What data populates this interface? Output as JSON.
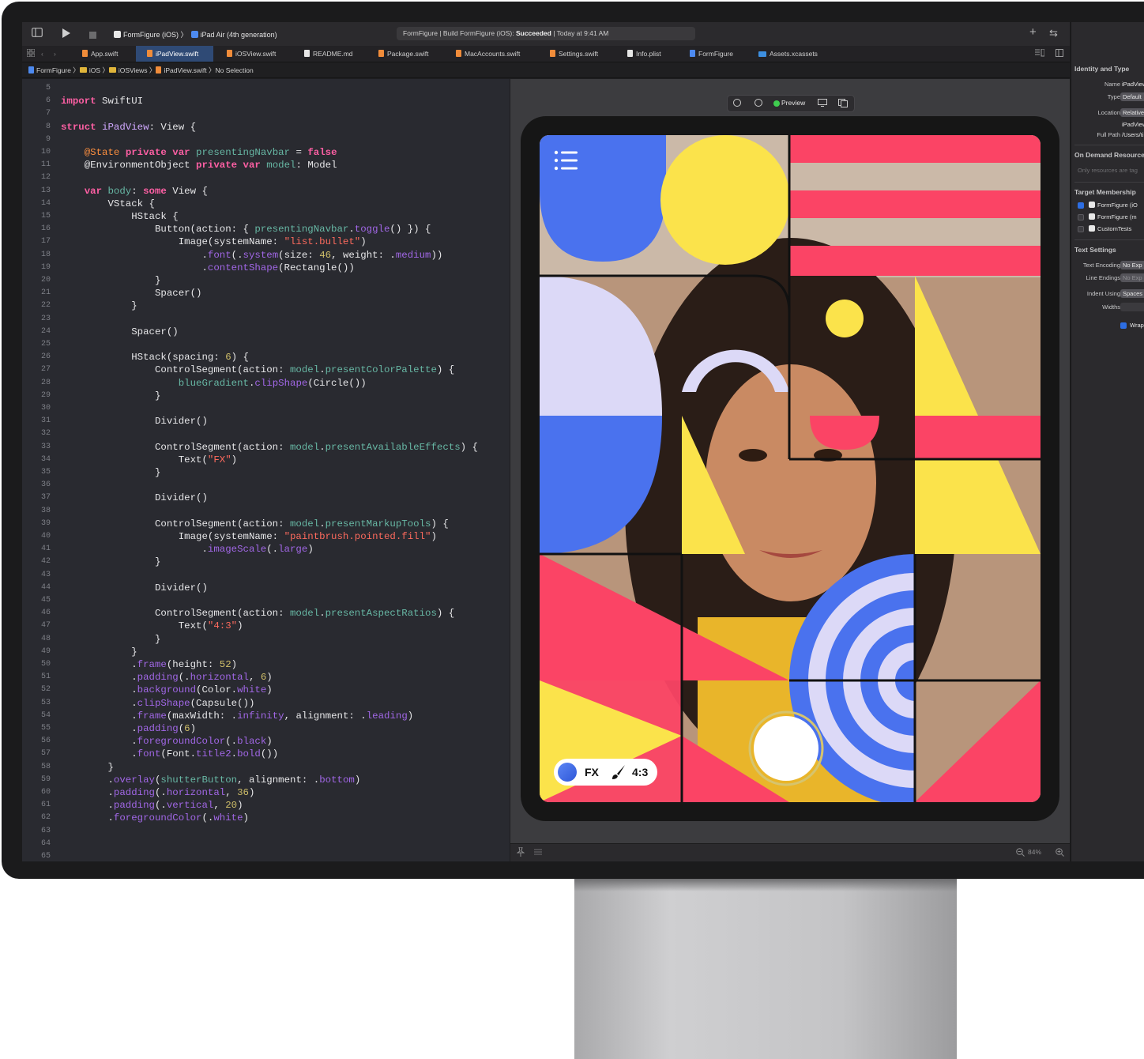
{
  "toolbar": {
    "scheme": "FormFigure (iOS)",
    "device": "iPad Air (4th generation)",
    "status_prefix": "FormFigure | Build FormFigure (iOS): ",
    "status_result": "Succeeded",
    "status_time": " | Today at 9:41 AM",
    "add_label": "+",
    "swap_label": "⇆"
  },
  "tabs": [
    {
      "label": "App.swift"
    },
    {
      "label": "iPadView.swift"
    },
    {
      "label": "iOSView.swift"
    },
    {
      "label": "README.md"
    },
    {
      "label": "Package.swift"
    },
    {
      "label": "MacAccounts.swift"
    },
    {
      "label": "Settings.swift"
    },
    {
      "label": "Info.plist"
    },
    {
      "label": "FormFigure"
    },
    {
      "label": "Assets.xcassets"
    }
  ],
  "breadcrumb": {
    "project": "FormFigure",
    "group1": "iOS",
    "group2": "iOSViews",
    "file": "iPadView.swift",
    "selection": "No Selection"
  },
  "editor": {
    "line_numbers": [
      "5",
      "6",
      "7",
      "8",
      "9",
      "10",
      "11",
      "12",
      "13",
      "14",
      "15",
      "16",
      "17",
      "18",
      "19",
      "20",
      "21",
      "22",
      "23",
      "24",
      "25",
      "26",
      "27",
      "28",
      "29",
      "30",
      "31",
      "32",
      "33",
      "34",
      "35",
      "36",
      "37",
      "38",
      "39",
      "40",
      "41",
      "42",
      "43",
      "44",
      "45",
      "46",
      "47",
      "48",
      "49",
      "50",
      "51",
      "52",
      "53",
      "54",
      "55",
      "56",
      "57",
      "58",
      "59",
      "60",
      "61",
      "62",
      "63",
      "64",
      "65"
    ],
    "lines": [
      [],
      [
        [
          "kw",
          "import"
        ],
        [
          "p",
          " SwiftUI"
        ]
      ],
      [],
      [
        [
          "kw",
          "struct"
        ],
        [
          "p",
          " "
        ],
        [
          "ty",
          "iPadView"
        ],
        [
          "p",
          ": View {"
        ]
      ],
      [],
      [
        [
          "p",
          "    "
        ],
        [
          "at",
          "@State"
        ],
        [
          "p",
          " "
        ],
        [
          "kw",
          "private var"
        ],
        [
          "p",
          " "
        ],
        [
          "fn",
          "presentingNavbar"
        ],
        [
          "p",
          " = "
        ],
        [
          "kw",
          "false"
        ]
      ],
      [
        [
          "p",
          "    @EnvironmentObject "
        ],
        [
          "kw",
          "private var"
        ],
        [
          "p",
          " "
        ],
        [
          "fn",
          "model"
        ],
        [
          "p",
          ": Model"
        ]
      ],
      [],
      [
        [
          "p",
          "    "
        ],
        [
          "kw",
          "var"
        ],
        [
          "p",
          " "
        ],
        [
          "fn",
          "body"
        ],
        [
          "p",
          ": "
        ],
        [
          "kw",
          "some"
        ],
        [
          "p",
          " View {"
        ]
      ],
      [
        [
          "p",
          "        VStack {"
        ]
      ],
      [
        [
          "p",
          "            HStack {"
        ]
      ],
      [
        [
          "p",
          "                Button(action: { "
        ],
        [
          "fn",
          "presentingNavbar"
        ],
        [
          "p",
          "."
        ],
        [
          "cs",
          "toggle"
        ],
        [
          "p",
          "() }) {"
        ]
      ],
      [
        [
          "p",
          "                    Image(systemName: "
        ],
        [
          "st",
          "\"list.bullet\""
        ],
        [
          "p",
          ")"
        ]
      ],
      [
        [
          "p",
          "                        ."
        ],
        [
          "cs",
          "font"
        ],
        [
          "p",
          "(."
        ],
        [
          "cs",
          "system"
        ],
        [
          "p",
          "(size: "
        ],
        [
          "nu",
          "46"
        ],
        [
          "p",
          ", weight: ."
        ],
        [
          "cs",
          "medium"
        ],
        [
          "p",
          "))"
        ]
      ],
      [
        [
          "p",
          "                        ."
        ],
        [
          "cs",
          "contentShape"
        ],
        [
          "p",
          "(Rectangle())"
        ]
      ],
      [
        [
          "p",
          "                }"
        ]
      ],
      [
        [
          "p",
          "                Spacer()"
        ]
      ],
      [
        [
          "p",
          "            }"
        ]
      ],
      [],
      [
        [
          "p",
          "            Spacer()"
        ]
      ],
      [],
      [
        [
          "p",
          "            HStack(spacing: "
        ],
        [
          "nu",
          "6"
        ],
        [
          "p",
          ") {"
        ]
      ],
      [
        [
          "p",
          "                ControlSegment(action: "
        ],
        [
          "fn",
          "model"
        ],
        [
          "p",
          "."
        ],
        [
          "fn",
          "presentColorPalette"
        ],
        [
          "p",
          ") {"
        ]
      ],
      [
        [
          "p",
          "                    "
        ],
        [
          "fn",
          "blueGradient"
        ],
        [
          "p",
          "."
        ],
        [
          "cs",
          "clipShape"
        ],
        [
          "p",
          "(Circle())"
        ]
      ],
      [
        [
          "p",
          "                }"
        ]
      ],
      [],
      [
        [
          "p",
          "                Divider()"
        ]
      ],
      [],
      [
        [
          "p",
          "                ControlSegment(action: "
        ],
        [
          "fn",
          "model"
        ],
        [
          "p",
          "."
        ],
        [
          "fn",
          "presentAvailableEffects"
        ],
        [
          "p",
          ") {"
        ]
      ],
      [
        [
          "p",
          "                    Text("
        ],
        [
          "st",
          "\"FX\""
        ],
        [
          "p",
          ")"
        ]
      ],
      [
        [
          "p",
          "                }"
        ]
      ],
      [],
      [
        [
          "p",
          "                Divider()"
        ]
      ],
      [],
      [
        [
          "p",
          "                ControlSegment(action: "
        ],
        [
          "fn",
          "model"
        ],
        [
          "p",
          "."
        ],
        [
          "fn",
          "presentMarkupTools"
        ],
        [
          "p",
          ") {"
        ]
      ],
      [
        [
          "p",
          "                    Image(systemName: "
        ],
        [
          "st",
          "\"paintbrush.pointed.fill\""
        ],
        [
          "p",
          ")"
        ]
      ],
      [
        [
          "p",
          "                        ."
        ],
        [
          "cs",
          "imageScale"
        ],
        [
          "p",
          "(."
        ],
        [
          "cs",
          "large"
        ],
        [
          "p",
          ")"
        ]
      ],
      [
        [
          "p",
          "                }"
        ]
      ],
      [],
      [
        [
          "p",
          "                Divider()"
        ]
      ],
      [],
      [
        [
          "p",
          "                ControlSegment(action: "
        ],
        [
          "fn",
          "model"
        ],
        [
          "p",
          "."
        ],
        [
          "fn",
          "presentAspectRatios"
        ],
        [
          "p",
          ") {"
        ]
      ],
      [
        [
          "p",
          "                    Text("
        ],
        [
          "st",
          "\"4:3\""
        ],
        [
          "p",
          ")"
        ]
      ],
      [
        [
          "p",
          "                }"
        ]
      ],
      [
        [
          "p",
          "            }"
        ]
      ],
      [
        [
          "p",
          "            ."
        ],
        [
          "cs",
          "frame"
        ],
        [
          "p",
          "(height: "
        ],
        [
          "nu",
          "52"
        ],
        [
          "p",
          ")"
        ]
      ],
      [
        [
          "p",
          "            ."
        ],
        [
          "cs",
          "padding"
        ],
        [
          "p",
          "(."
        ],
        [
          "cs",
          "horizontal"
        ],
        [
          "p",
          ", "
        ],
        [
          "nu",
          "6"
        ],
        [
          "p",
          ")"
        ]
      ],
      [
        [
          "p",
          "            ."
        ],
        [
          "cs",
          "background"
        ],
        [
          "p",
          "(Color."
        ],
        [
          "cs",
          "white"
        ],
        [
          "p",
          ")"
        ]
      ],
      [
        [
          "p",
          "            ."
        ],
        [
          "cs",
          "clipShape"
        ],
        [
          "p",
          "(Capsule())"
        ]
      ],
      [
        [
          "p",
          "            ."
        ],
        [
          "cs",
          "frame"
        ],
        [
          "p",
          "(maxWidth: ."
        ],
        [
          "cs",
          "infinity"
        ],
        [
          "p",
          ", alignment: ."
        ],
        [
          "cs",
          "leading"
        ],
        [
          "p",
          ")"
        ]
      ],
      [
        [
          "p",
          "            ."
        ],
        [
          "cs",
          "padding"
        ],
        [
          "p",
          "("
        ],
        [
          "nu",
          "6"
        ],
        [
          "p",
          ")"
        ]
      ],
      [
        [
          "p",
          "            ."
        ],
        [
          "cs",
          "foregroundColor"
        ],
        [
          "p",
          "(."
        ],
        [
          "cs",
          "black"
        ],
        [
          "p",
          ")"
        ]
      ],
      [
        [
          "p",
          "            ."
        ],
        [
          "cs",
          "font"
        ],
        [
          "p",
          "(Font."
        ],
        [
          "cs",
          "title2"
        ],
        [
          "p",
          "."
        ],
        [
          "cs",
          "bold"
        ],
        [
          "p",
          "())"
        ]
      ],
      [
        [
          "p",
          "        }"
        ]
      ],
      [
        [
          "p",
          "        ."
        ],
        [
          "cs",
          "overlay"
        ],
        [
          "p",
          "("
        ],
        [
          "fn",
          "shutterButton"
        ],
        [
          "p",
          ", alignment: ."
        ],
        [
          "cs",
          "bottom"
        ],
        [
          "p",
          ")"
        ]
      ],
      [
        [
          "p",
          "        ."
        ],
        [
          "cs",
          "padding"
        ],
        [
          "p",
          "(."
        ],
        [
          "cs",
          "horizontal"
        ],
        [
          "p",
          ", "
        ],
        [
          "nu",
          "36"
        ],
        [
          "p",
          ")"
        ]
      ],
      [
        [
          "p",
          "        ."
        ],
        [
          "cs",
          "padding"
        ],
        [
          "p",
          "(."
        ],
        [
          "cs",
          "vertical"
        ],
        [
          "p",
          ", "
        ],
        [
          "nu",
          "20"
        ],
        [
          "p",
          ")"
        ]
      ],
      [
        [
          "p",
          "        ."
        ],
        [
          "cs",
          "foregroundColor"
        ],
        [
          "p",
          "(."
        ],
        [
          "cs",
          "white"
        ],
        [
          "p",
          ")"
        ]
      ],
      [],
      [],
      []
    ]
  },
  "preview": {
    "label": "Preview",
    "controls": {
      "fx_label": "FX",
      "ratio_label": "4:3"
    },
    "zoom": "84%",
    "colors": {
      "blue": "#4a72ee",
      "yellow": "#fbe34b",
      "pink": "#fb4465",
      "lavender": "#dcd9f7"
    }
  },
  "inspector": {
    "identity_title": "Identity and Type",
    "name_label": "Name",
    "name_value": "iPadView",
    "type_label": "Type",
    "type_value": "Default",
    "location_label": "Location",
    "location_value": "Relative",
    "location_file": "iPadView",
    "fullpath_label": "Full Path",
    "fullpath_value": "/Users/ti",
    "ondemand_title": "On Demand Resource",
    "ondemand_hint": "Only resources are tag",
    "target_title": "Target Membership",
    "targets": [
      {
        "label": "FormFigure (iO",
        "checked": true
      },
      {
        "label": "FormFigure (m",
        "checked": false
      },
      {
        "label": "CustomTests",
        "checked": false
      }
    ],
    "text_title": "Text Settings",
    "encoding_label": "Text Encoding",
    "encoding_value": "No Exp",
    "endings_label": "Line Endings",
    "endings_value": "No Exp",
    "indent_label": "Indent Using",
    "indent_value": "Spaces",
    "widths_label": "Widths",
    "wrap_label": "Wrap"
  }
}
